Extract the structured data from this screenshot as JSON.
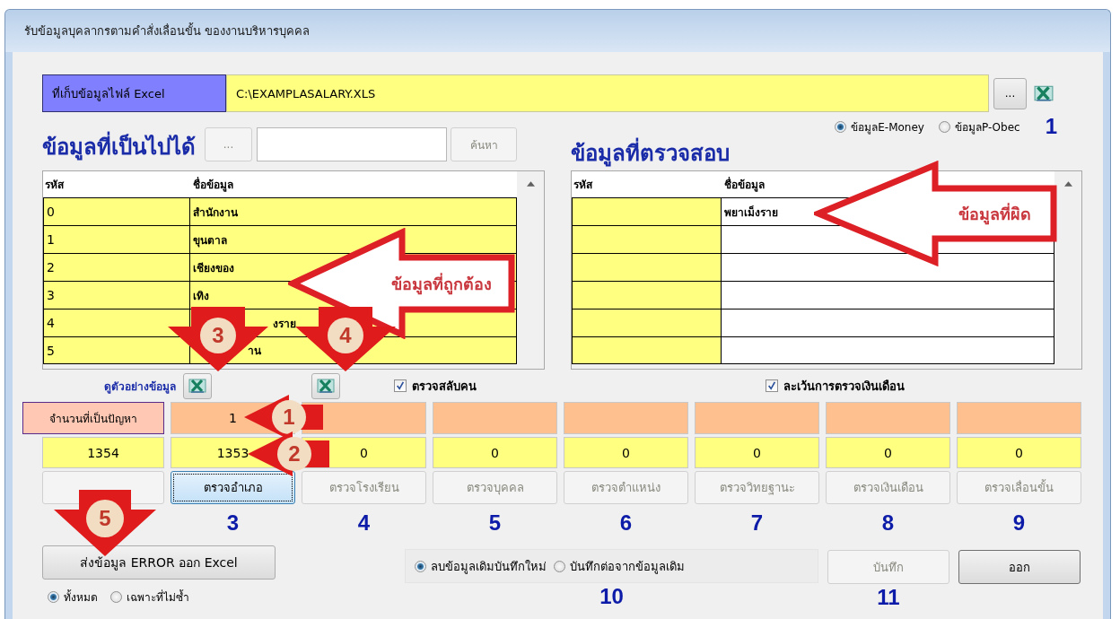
{
  "window": {
    "title": "รับข้อมูลบุคลากรตามคำสั่งเลื่อนขั้น ของงานบริหารบุคคล"
  },
  "excel_path": {
    "label": "ที่เก็บข้อมูลไฟล์ Excel",
    "value": "C:\\EXAMPLASALARY.XLS",
    "browse_button": "..."
  },
  "source_options": [
    {
      "label": "ข้อมูลE-Money",
      "selected": true
    },
    {
      "label": "ข้อมูลP-Obec",
      "selected": false
    }
  ],
  "source_step": "1",
  "available": {
    "heading": "ข้อมูลที่เป็นไปได้",
    "browse_button": "...",
    "search_button": "ค้นหา",
    "columns": [
      "รหัส",
      "ชื่อข้อมูล"
    ],
    "rows": [
      {
        "code": "0",
        "name": "สำนักงาน"
      },
      {
        "code": "1",
        "name": "ขุนตาล"
      },
      {
        "code": "2",
        "name": "เชียงของ"
      },
      {
        "code": "3",
        "name": "เทิง"
      },
      {
        "code": "4",
        "name": "งราย"
      },
      {
        "code": "5",
        "name": "าน"
      }
    ]
  },
  "checked": {
    "heading": "ข้อมูลที่ตรวจสอบ",
    "columns": [
      "รหัส",
      "ชื่อข้อมูล"
    ],
    "rows": [
      {
        "name": "พยาเม็งราย"
      }
    ]
  },
  "preview_label": "ดูตัวอย่างข้อมูล",
  "options": [
    {
      "label": "ตรวจสลับคน",
      "checked": true
    },
    {
      "label": "ละเว้นการตรวจเงินเดือน",
      "checked": true
    }
  ],
  "problem_label": "จำนวนที่เป็นปัญหา",
  "load": {
    "count": "1354",
    "disabled": true
  },
  "steps": [
    {
      "problem": "1",
      "count": "1353",
      "button": "ตรวจอำเภอ",
      "disabled": false,
      "focused": true,
      "step": "3"
    },
    {
      "count": "0",
      "button": "ตรวจโรงเรียน",
      "disabled": true,
      "focused": false,
      "step": "4"
    },
    {
      "count": "0",
      "button": "ตรวจบุคคล",
      "disabled": true,
      "focused": false,
      "step": "5"
    },
    {
      "count": "0",
      "button": "ตรวจตำแหน่ง",
      "disabled": true,
      "focused": false,
      "step": "6"
    },
    {
      "count": "0",
      "button": "ตรวจวิทยฐานะ",
      "disabled": true,
      "focused": false,
      "step": "7"
    },
    {
      "count": "0",
      "button": "ตรวจเงินเดือน",
      "disabled": true,
      "focused": false,
      "step": "8"
    },
    {
      "count": "0",
      "button": "ตรวจเลื่อนขั้น",
      "disabled": true,
      "focused": false,
      "step": "9"
    }
  ],
  "export": {
    "button": "ส่งข้อมูล ERROR ออก Excel",
    "scope": [
      {
        "label": "ทั้งหมด",
        "selected": true
      },
      {
        "label": "เฉพาะที่ไม่ซ้ำ",
        "selected": false
      }
    ]
  },
  "save_mode": {
    "options": [
      {
        "label": "ลบข้อมูลเดิมบันทึกใหม่",
        "selected": true
      },
      {
        "label": "บันทึกต่อจากข้อมูลเดิม",
        "selected": false
      }
    ],
    "step": "10"
  },
  "save_button": {
    "label": "บันทึก",
    "disabled": true,
    "step": "11"
  },
  "exit_button": {
    "label": "ออก",
    "disabled": false
  },
  "callouts": [
    {
      "kind": "big_arrow",
      "text": "ข้อมูลที่ผิด"
    },
    {
      "kind": "big_arrow",
      "text": "ข้อมูลที่ถูกต้อง"
    },
    {
      "kind": "down_arrow",
      "text": "3"
    },
    {
      "kind": "down_arrow",
      "text": "4"
    },
    {
      "kind": "left_arrow",
      "text": "1"
    },
    {
      "kind": "left_arrow",
      "text": "2"
    },
    {
      "kind": "down_arrow",
      "text": "5"
    }
  ]
}
